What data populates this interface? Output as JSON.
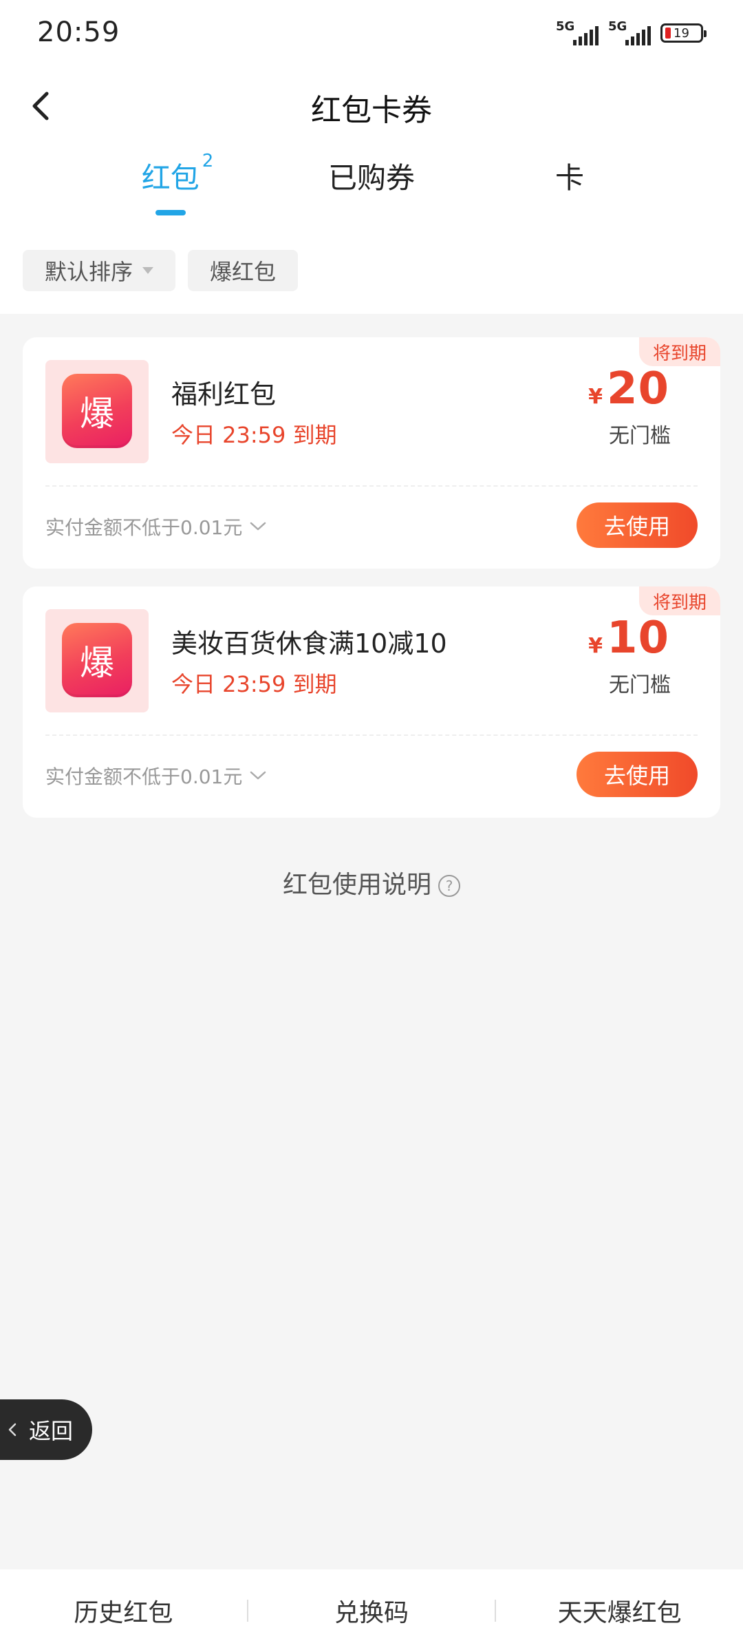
{
  "status": {
    "time": "20:59",
    "signal1": "5G",
    "signal2": "5G",
    "battery": "19"
  },
  "nav": {
    "title": "红包卡券"
  },
  "tabs": [
    {
      "label": "红包",
      "badge": "2"
    },
    {
      "label": "已购券"
    },
    {
      "label": "卡"
    }
  ],
  "filters": {
    "sort_label": "默认排序",
    "tag_label": "爆红包"
  },
  "coupons": [
    {
      "tag": "将到期",
      "logo_char": "爆",
      "title": "福利红包",
      "expiry": "今日 23:59 到期",
      "currency": "¥",
      "amount": "20",
      "threshold": "无门槛",
      "condition": "实付金额不低于0.01元",
      "button": "去使用"
    },
    {
      "tag": "将到期",
      "logo_char": "爆",
      "title": "美妆百货休食满10减10",
      "expiry": "今日 23:59 到期",
      "currency": "¥",
      "amount": "10",
      "threshold": "无门槛",
      "condition": "实付金额不低于0.01元",
      "button": "去使用"
    }
  ],
  "usage": {
    "label": "红包使用说明",
    "icon": "?"
  },
  "float_back": {
    "label": "返回"
  },
  "bottom": {
    "items": [
      "历史红包",
      "兑换码",
      "天天爆红包"
    ]
  },
  "colors": {
    "accent_blue": "#22a5e6",
    "accent_red": "#e8452c",
    "button_gradient_start": "#ff7a3c",
    "button_gradient_end": "#f04a2a"
  }
}
